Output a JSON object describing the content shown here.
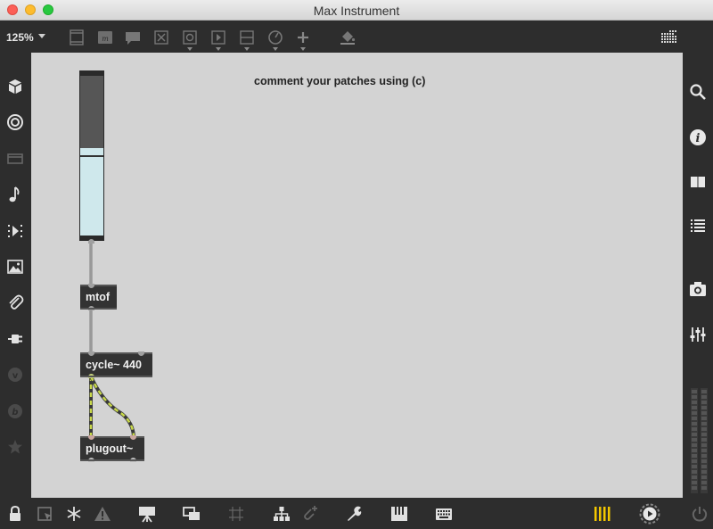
{
  "window": {
    "title": "Max Instrument"
  },
  "toolbar": {
    "zoom": "125%",
    "icons": [
      "presentation-mode-icon",
      "message-box-icon",
      "comment-icon",
      "toggle-object-icon",
      "button-object-icon",
      "player-icon",
      "slider-object-icon",
      "dial-object-icon",
      "add-object-icon",
      "paint-bucket-icon",
      "grid-toggle-icon"
    ]
  },
  "left_sidebar": {
    "icons": [
      "package-icon",
      "target-icon",
      "window-icon",
      "music-note-icon",
      "play-sequence-icon",
      "image-icon",
      "paperclip-icon",
      "plug-icon",
      "vimeo-icon",
      "bandcamp-icon",
      "star-icon"
    ]
  },
  "right_sidebar": {
    "icons": [
      "search-icon",
      "info-icon",
      "book-icon",
      "list-icon",
      "camera-icon",
      "mixer-icon",
      "level-meter-icon"
    ]
  },
  "bottom_bar": {
    "icons": [
      "lock-icon",
      "edit-mode-icon",
      "freeze-icon",
      "warning-icon",
      "presentation-icon",
      "windows-icon",
      "grid-icon",
      "hierarchy-icon",
      "add-link-icon",
      "wrench-icon",
      "piano-icon",
      "keyboard-icon",
      "meter-bars-icon",
      "audio-play-icon",
      "power-icon"
    ],
    "accent": "#f2c600"
  },
  "patch": {
    "comment": "comment your patches using (c)",
    "slider": {
      "value_fraction": 0.55,
      "fill_color": "#cfe8ec"
    },
    "objects": [
      {
        "text": "mtof"
      },
      {
        "text": "cycle~ 440"
      },
      {
        "text": "plugout~"
      }
    ]
  }
}
